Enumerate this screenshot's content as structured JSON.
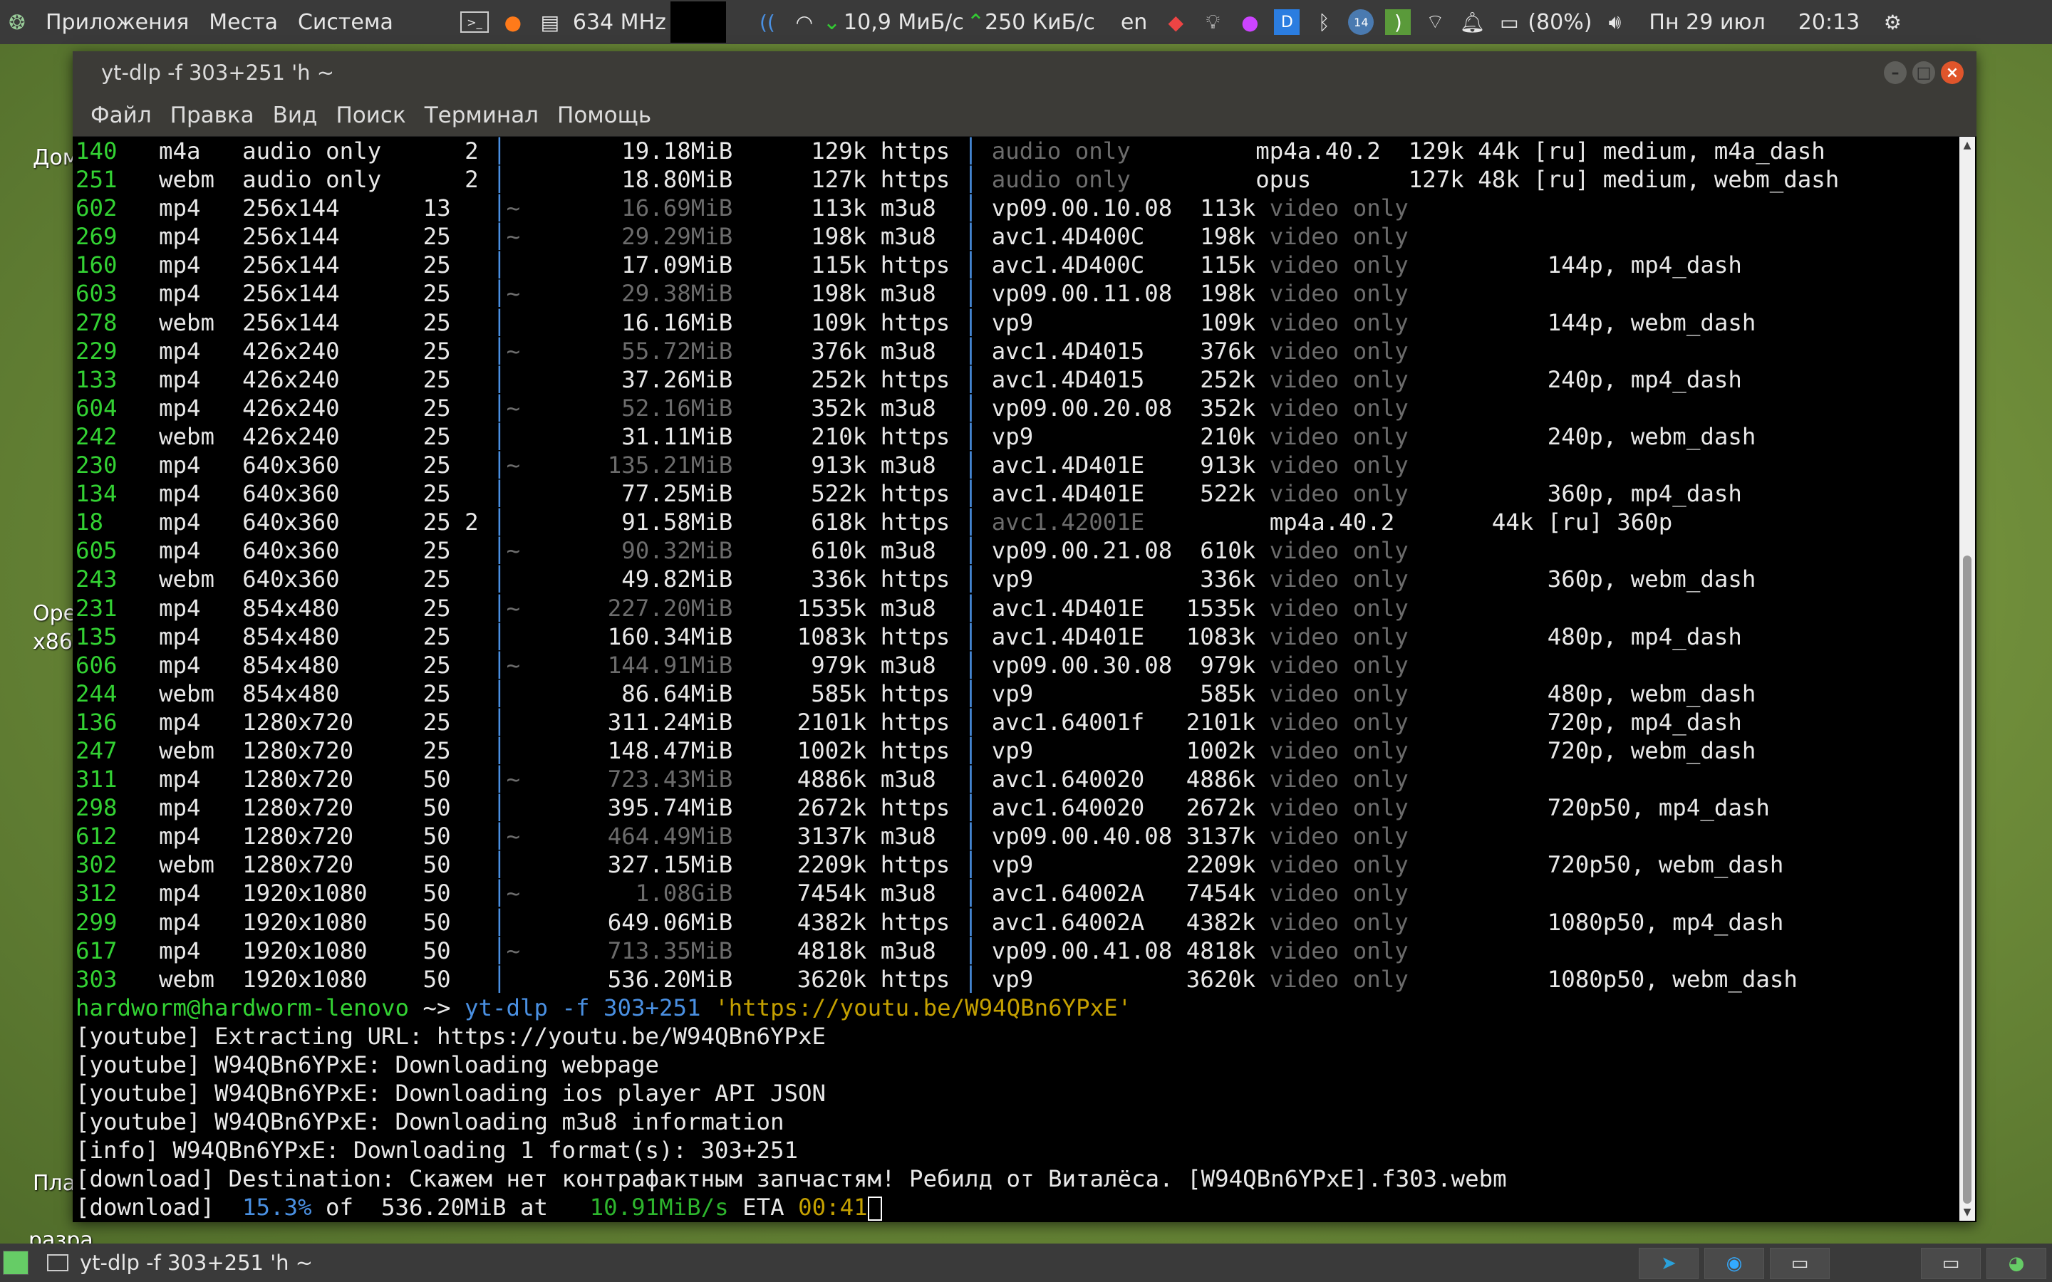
{
  "top_panel": {
    "menus": [
      "Приложения",
      "Места",
      "Система"
    ],
    "cpu_freq": "634 MHz",
    "net_down": "10,9 МиБ/с",
    "net_up": "250 КиБ/с",
    "lang": "en",
    "battery": "(80%)",
    "date": "Пн 29 июл",
    "time": "20:13",
    "badge": "14",
    "icons": [
      "terminal-icon",
      "firefox-icon",
      "system-monitor-icon",
      "dark-box-icon",
      "network-activity-icon",
      "bulb-icon",
      "app-icon",
      "d-icon",
      "bluetooth-icon",
      "updates-icon",
      "rss-icon",
      "wifi-icon",
      "bell-icon",
      "battery-icon",
      "volume-icon",
      "gear-icon"
    ]
  },
  "desktop_labels": [
    "Дом",
    "Ope",
    "x86",
    "Пла",
    "разра"
  ],
  "window": {
    "title": "yt-dlp -f 303+251 'h ~",
    "menus": [
      "Файл",
      "Правка",
      "Вид",
      "Поиск",
      "Терминал",
      "Помощь"
    ]
  },
  "format_rows": [
    [
      "140",
      "m4a ",
      "audio only ",
      "   2",
      " ",
      "19.18MiB",
      "129k",
      "https ",
      "audio only         ",
      "mp4a.40.2  129k 44k [ru] medium, m4a_dash",
      1,
      0
    ],
    [
      "251",
      "webm",
      "audio only ",
      "   2",
      " ",
      "18.80MiB",
      "127k",
      "https ",
      "audio only         ",
      "opus       127k 48k [ru] medium, webm_dash",
      1,
      0
    ],
    [
      "602",
      "mp4 ",
      "256x144    ",
      "13  ",
      "~",
      " 16.69MiB",
      "113k",
      "m3u8  ",
      "vp09.00.10.08  113k ",
      "video only",
      0,
      1
    ],
    [
      "269",
      "mp4 ",
      "256x144    ",
      "25  ",
      "~",
      " 29.29MiB",
      "198k",
      "m3u8  ",
      "avc1.4D400C    198k ",
      "video only",
      0,
      1
    ],
    [
      "160",
      "mp4 ",
      "256x144    ",
      "25  ",
      " ",
      "17.09MiB",
      "115k",
      "https ",
      "avc1.4D400C    115k ",
      "video only          144p, mp4_dash",
      0,
      0
    ],
    [
      "603",
      "mp4 ",
      "256x144    ",
      "25  ",
      "~",
      " 29.38MiB",
      "198k",
      "m3u8  ",
      "vp09.00.11.08  198k ",
      "video only",
      0,
      1
    ],
    [
      "278",
      "webm",
      "256x144    ",
      "25  ",
      " ",
      "16.16MiB",
      "109k",
      "https ",
      "vp9            109k ",
      "video only          144p, webm_dash",
      0,
      0
    ],
    [
      "229",
      "mp4 ",
      "426x240    ",
      "25  ",
      "~",
      " 55.72MiB",
      "376k",
      "m3u8  ",
      "avc1.4D4015    376k ",
      "video only",
      0,
      1
    ],
    [
      "133",
      "mp4 ",
      "426x240    ",
      "25  ",
      " ",
      "37.26MiB",
      "252k",
      "https ",
      "avc1.4D4015    252k ",
      "video only          240p, mp4_dash",
      0,
      0
    ],
    [
      "604",
      "mp4 ",
      "426x240    ",
      "25  ",
      "~",
      " 52.16MiB",
      "352k",
      "m3u8  ",
      "vp09.00.20.08  352k ",
      "video only",
      0,
      1
    ],
    [
      "242",
      "webm",
      "426x240    ",
      "25  ",
      " ",
      "31.11MiB",
      "210k",
      "https ",
      "vp9            210k ",
      "video only          240p, webm_dash",
      0,
      0
    ],
    [
      "230",
      "mp4 ",
      "640x360    ",
      "25  ",
      "~",
      "135.21MiB",
      "913k",
      "m3u8  ",
      "avc1.4D401E    913k ",
      "video only",
      0,
      1
    ],
    [
      "134",
      "mp4 ",
      "640x360    ",
      "25  ",
      " ",
      "77.25MiB",
      "522k",
      "https ",
      "avc1.4D401E    522k ",
      "video only          360p, mp4_dash",
      0,
      0
    ],
    [
      "18 ",
      "mp4 ",
      "640x360    ",
      "25 2",
      " ",
      "91.58MiB",
      "618k",
      "https ",
      "avc1.42001E         ",
      "mp4a.40.2       44k [ru] 360p",
      1,
      0
    ],
    [
      "605",
      "mp4 ",
      "640x360    ",
      "25  ",
      "~",
      " 90.32MiB",
      "610k",
      "m3u8  ",
      "vp09.00.21.08  610k ",
      "video only",
      0,
      1
    ],
    [
      "243",
      "webm",
      "640x360    ",
      "25  ",
      " ",
      "49.82MiB",
      "336k",
      "https ",
      "vp9            336k ",
      "video only          360p, webm_dash",
      0,
      0
    ],
    [
      "231",
      "mp4 ",
      "854x480    ",
      "25  ",
      "~",
      "227.20MiB",
      "1535k",
      "m3u8  ",
      "avc1.4D401E   1535k ",
      "video only",
      0,
      1
    ],
    [
      "135",
      "mp4 ",
      "854x480    ",
      "25  ",
      " ",
      "160.34MiB",
      "1083k",
      "https ",
      "avc1.4D401E   1083k ",
      "video only          480p, mp4_dash",
      0,
      0
    ],
    [
      "606",
      "mp4 ",
      "854x480    ",
      "25  ",
      "~",
      "144.91MiB",
      "979k",
      "m3u8  ",
      "vp09.00.30.08  979k ",
      "video only",
      0,
      1
    ],
    [
      "244",
      "webm",
      "854x480    ",
      "25  ",
      " ",
      "86.64MiB",
      "585k",
      "https ",
      "vp9            585k ",
      "video only          480p, webm_dash",
      0,
      0
    ],
    [
      "136",
      "mp4 ",
      "1280x720   ",
      "25  ",
      " ",
      "311.24MiB",
      "2101k",
      "https ",
      "avc1.64001f   2101k ",
      "video only          720p, mp4_dash",
      0,
      0
    ],
    [
      "247",
      "webm",
      "1280x720   ",
      "25  ",
      " ",
      "148.47MiB",
      "1002k",
      "https ",
      "vp9           1002k ",
      "video only          720p, webm_dash",
      0,
      0
    ],
    [
      "311",
      "mp4 ",
      "1280x720   ",
      "50  ",
      "~",
      "723.43MiB",
      "4886k",
      "m3u8  ",
      "avc1.640020   4886k ",
      "video only",
      0,
      1
    ],
    [
      "298",
      "mp4 ",
      "1280x720   ",
      "50  ",
      " ",
      "395.74MiB",
      "2672k",
      "https ",
      "avc1.640020   2672k ",
      "video only          720p50, mp4_dash",
      0,
      0
    ],
    [
      "612",
      "mp4 ",
      "1280x720   ",
      "50  ",
      "~",
      "464.49MiB",
      "3137k",
      "m3u8  ",
      "vp09.00.40.08 3137k ",
      "video only",
      0,
      1
    ],
    [
      "302",
      "webm",
      "1280x720   ",
      "50  ",
      " ",
      "327.15MiB",
      "2209k",
      "https ",
      "vp9           2209k ",
      "video only          720p50, webm_dash",
      0,
      0
    ],
    [
      "312",
      "mp4 ",
      "1920x1080  ",
      "50  ",
      "~",
      "  1.08GiB",
      "7454k",
      "m3u8  ",
      "avc1.64002A   7454k ",
      "video only",
      0,
      1
    ],
    [
      "299",
      "mp4 ",
      "1920x1080  ",
      "50  ",
      " ",
      "649.06MiB",
      "4382k",
      "https ",
      "avc1.64002A   4382k ",
      "video only          1080p50, mp4_dash",
      0,
      0
    ],
    [
      "617",
      "mp4 ",
      "1920x1080  ",
      "50  ",
      "~",
      "713.35MiB",
      "4818k",
      "m3u8  ",
      "vp09.00.41.08 4818k ",
      "video only",
      0,
      1
    ],
    [
      "303",
      "webm",
      "1920x1080  ",
      "50  ",
      " ",
      "536.20MiB",
      "3620k",
      "https ",
      "vp9           3620k ",
      "video only          1080p50, webm_dash",
      0,
      0
    ]
  ],
  "prompt": {
    "userhost": "hardworm@hardworm-lenovo",
    "dir": " ~> ",
    "command": "yt-dlp -f 303+251 ",
    "url": "'https://youtu.be/W94QBn6YPxE'"
  },
  "log_lines": [
    "[youtube] Extracting URL: https://youtu.be/W94QBn6YPxE",
    "[youtube] W94QBn6YPxE: Downloading webpage",
    "[youtube] W94QBn6YPxE: Downloading ios player API JSON",
    "[youtube] W94QBn6YPxE: Downloading m3u8 information",
    "[info] W94QBn6YPxE: Downloading 1 format(s): 303+251",
    "[download] Destination: Скажем нет контрафактным запчастям! Ребилд от Виталёса. [W94QBn6YPxE].f303.webm"
  ],
  "progress": {
    "prefix": "[download] ",
    "percent": " 15.3%",
    "of": " of  536.20MiB at   ",
    "speed": "10.91MiB/s",
    "eta_label": " ETA ",
    "eta": "00:41"
  },
  "taskbar": {
    "task_title": "yt-dlp -f 303+251 'h ~"
  }
}
